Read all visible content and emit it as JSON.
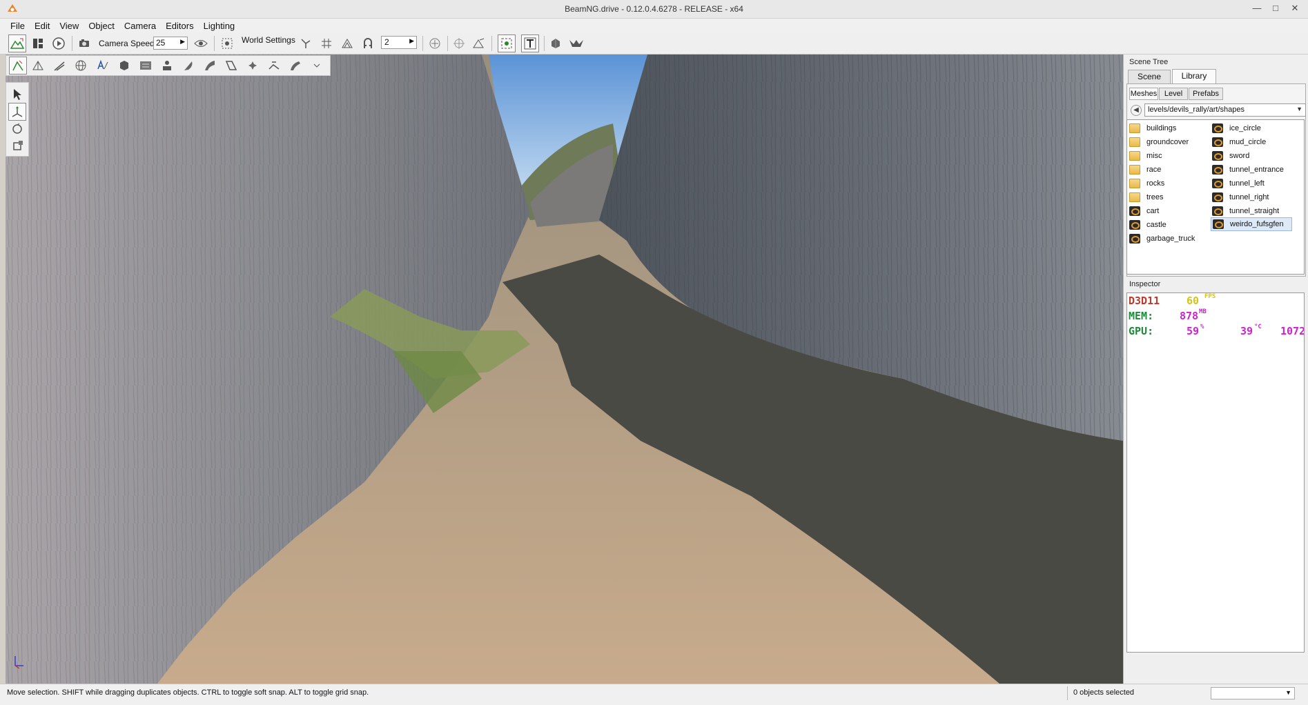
{
  "window": {
    "title": "BeamNG.drive - 0.12.0.4.6278 - RELEASE - x64",
    "minimize": "—",
    "maximize": "□",
    "close": "✕"
  },
  "menu": [
    "File",
    "Edit",
    "View",
    "Object",
    "Camera",
    "Editors",
    "Lighting"
  ],
  "toolbar": {
    "camera_speed_label": "Camera Speed",
    "camera_speed_value": "25",
    "world_settings_label": "World Settings",
    "grid_value": "2"
  },
  "scene_tree": {
    "title": "Scene Tree",
    "tabs": [
      "Scene",
      "Library"
    ],
    "selected_tab": "Library",
    "subtabs": [
      "Meshes",
      "Level",
      "Prefabs"
    ],
    "selected_subtab": "Meshes",
    "path": "levels/devils_rally/art/shapes",
    "left_items": [
      {
        "label": "buildings",
        "icon": "folder-icon"
      },
      {
        "label": "groundcover",
        "icon": "folder-icon"
      },
      {
        "label": "misc",
        "icon": "folder-icon"
      },
      {
        "label": "race",
        "icon": "folder-icon"
      },
      {
        "label": "rocks",
        "icon": "folder-icon"
      },
      {
        "label": "trees",
        "icon": "folder-icon"
      },
      {
        "label": "cart",
        "icon": "shape-icon"
      },
      {
        "label": "castle",
        "icon": "shape-icon"
      },
      {
        "label": "garbage_truck",
        "icon": "shape-icon"
      }
    ],
    "right_items": [
      {
        "label": "ice_circle",
        "icon": "shape-icon"
      },
      {
        "label": "mud_circle",
        "icon": "shape-icon"
      },
      {
        "label": "sword",
        "icon": "shape-icon"
      },
      {
        "label": "tunnel_entrance",
        "icon": "shape-icon"
      },
      {
        "label": "tunnel_left",
        "icon": "shape-icon"
      },
      {
        "label": "tunnel_right",
        "icon": "shape-icon"
      },
      {
        "label": "tunnel_straight",
        "icon": "shape-icon"
      },
      {
        "label": "weirdo_fufsgfen",
        "icon": "shape-icon",
        "selected": true
      }
    ]
  },
  "inspector": {
    "title": "Inspector",
    "d3d_label": "D3D11",
    "fps_value": "60",
    "fps_unit": "FPS",
    "mem_label": "MEM:",
    "mem_value": "878",
    "mem_unit": "MB",
    "gpu_label": "GPU:",
    "gpu_load": "59",
    "gpu_load_unit": "%",
    "gpu_temp": "39",
    "gpu_temp_unit": "°C",
    "gpu_extra": "1072",
    "colors": {
      "d3d": "#c0392b",
      "mem_label": "#1f8a3a",
      "magenta": "#d21fd2",
      "yellow": "#d6c21a"
    }
  },
  "status": {
    "message": "Move selection.  SHIFT while dragging duplicates objects.  CTRL to toggle soft snap.  ALT to toggle grid snap.",
    "objects_selected": "0 objects selected"
  }
}
